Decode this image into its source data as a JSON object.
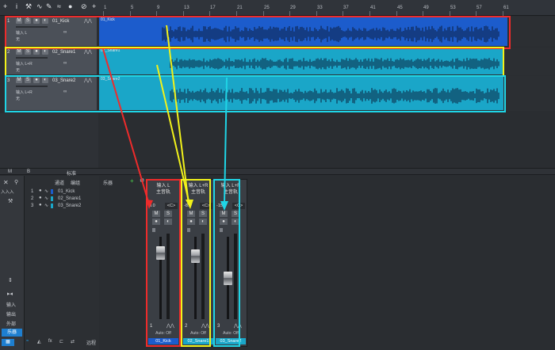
{
  "toolbar": {
    "icons": [
      "plus-icon",
      "info-icon",
      "wrench-icon",
      "curve-icon",
      "pencil-icon",
      "waveform-icon",
      "metronome-icon",
      "stopwatch-icon",
      "add-icon"
    ],
    "glyphs": [
      "+",
      "i",
      "⚒",
      "∿",
      "✎",
      "≈",
      "●",
      "⊘",
      "+"
    ]
  },
  "ruler": {
    "bars": [
      "1",
      "5",
      "9",
      "13",
      "17",
      "21",
      "25",
      "29",
      "33",
      "37",
      "41",
      "45",
      "49",
      "53",
      "57",
      "61"
    ]
  },
  "tracks": [
    {
      "index": "1",
      "mute": "M",
      "solo": "S",
      "name": "01_Kick",
      "input": "输入 L",
      "output": "无",
      "clip_label": "01_Kick",
      "color": "#1c5ccc"
    },
    {
      "index": "2",
      "mute": "M",
      "solo": "S",
      "name": "02_Snare1",
      "input": "输入 L+R",
      "output": "无",
      "clip_label": "02_Snare1",
      "color": "#1aa6c8"
    },
    {
      "index": "3",
      "mute": "M",
      "solo": "S",
      "name": "03_Snare2",
      "input": "输入 L+R",
      "output": "无",
      "clip_label": "03_Snare2",
      "color": "#1aa6c8"
    }
  ],
  "bottom_bar": {
    "m": "M",
    "b": "B",
    "standard": "标准"
  },
  "mixer_left": {
    "input_short": "入入入",
    "input": "输入",
    "output": "输出",
    "external": "外部",
    "instrument": "乐器",
    "remote": "远程"
  },
  "channel_list": {
    "header_channel": "通道",
    "header_group": "编组",
    "items": [
      {
        "num": "1",
        "name": "01_Kick"
      },
      {
        "num": "2",
        "name": "02_Snare1"
      },
      {
        "num": "3",
        "name": "03_Snare2"
      }
    ]
  },
  "instrument_panel": {
    "label": "乐器"
  },
  "strips": [
    {
      "input": "输入 L",
      "bus": "主音轨",
      "pan_value": "0.0",
      "pan": "<C>",
      "mute": "M",
      "solo": "S",
      "index": "1",
      "auto": "Auto: Off",
      "name": "01_Kick",
      "highlight": "#ee2b2b"
    },
    {
      "input": "输入 L+R",
      "bus": "主音轨",
      "pan_value": "-8.3",
      "pan": "<C>",
      "mute": "M",
      "solo": "S",
      "index": "2",
      "auto": "Auto: Off",
      "name": "02_Snare1",
      "highlight": "#f2f21a"
    },
    {
      "input": "输入 L+R",
      "bus": "主音轨",
      "pan_value": "-15.3",
      "pan": "<C>",
      "mute": "M",
      "solo": "S",
      "index": "3",
      "auto": "Auto: Off",
      "name": "03_Snare2",
      "highlight": "#1fd5e6"
    }
  ],
  "colors": {
    "red": "#ee2b2b",
    "yellow": "#f2f21a",
    "cyan": "#1fd5e6",
    "kick": "#1c5ccc",
    "snare": "#1aa6c8"
  }
}
